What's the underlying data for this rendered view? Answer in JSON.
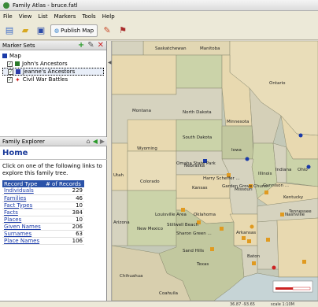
{
  "window": {
    "title": "Family Atlas - bruce.fatl"
  },
  "menu": [
    "File",
    "View",
    "List",
    "Markers",
    "Tools",
    "Help"
  ],
  "toolbar": {
    "publish_label": "Publish Map"
  },
  "folder_panel": {
    "title": "Marker Sets",
    "items": [
      {
        "label": "Map",
        "checked": false,
        "color": "#1a3aa8"
      },
      {
        "label": "John's Ancestors",
        "checked": true,
        "color": "#2a7a2a"
      },
      {
        "label": "Jeanne's Ancestors",
        "checked": true,
        "color": "#2a3aa8",
        "selected": true
      },
      {
        "label": "Civil War Battles",
        "checked": true,
        "color": "#cc2222"
      }
    ]
  },
  "explorer": {
    "title": "Family Explorer",
    "home": "Home",
    "description": "Click on one of the following links to explore this family tree.",
    "table": {
      "headers": [
        "Record Type",
        "# of Records"
      ],
      "rows": [
        [
          "Individuals",
          "229"
        ],
        [
          "Families",
          "46"
        ],
        [
          "Fact Types",
          "10"
        ],
        [
          "Facts",
          "384"
        ],
        [
          "Places",
          "10"
        ],
        [
          "Given Names",
          "206"
        ],
        [
          "Surnames",
          "63"
        ],
        [
          "Place Names",
          "106"
        ]
      ]
    }
  },
  "map": {
    "labels": {
      "saskatchewan": "Saskatchewan",
      "manitoba": "Manitoba",
      "ontario": "Ontario",
      "montana": "Montana",
      "north_dakota": "North Dakota",
      "minnesota": "Minnesota",
      "south_dakota": "South Dakota",
      "wyoming": "Wyoming",
      "iowa": "Iowa",
      "nebraska": "Nebraska",
      "illinois": "Illinois",
      "indiana": "Indiana",
      "ohio": "Ohio",
      "utah": "Utah",
      "colorado": "Colorado",
      "kansas": "Kansas",
      "missouri": "Missouri",
      "kentucky": "Kentucky",
      "tennessee": "Tennessee",
      "arizona": "Arizona",
      "new_mexico": "New Mexico",
      "oklahoma": "Oklahoma",
      "arkansas": "Arkansas",
      "texas": "Texas",
      "chihuahua": "Chihuahua",
      "coahuila": "Coahuila",
      "pt1": "Omaha State Park",
      "pt2": "Harry Scheffer ...",
      "pt3": "Garden Grove Church",
      "pt4": "Gunnison ...",
      "pt5": "Louisville Area",
      "pt6": "Stillwell Beach",
      "pt7": "Sharon Green ...",
      "pt8": "Sand Hills",
      "pt9": "Nashville",
      "pt10": "Baton"
    }
  },
  "status": {
    "left": "",
    "coords": "36.87 -93.65",
    "zoom": "scale 1:10M"
  }
}
